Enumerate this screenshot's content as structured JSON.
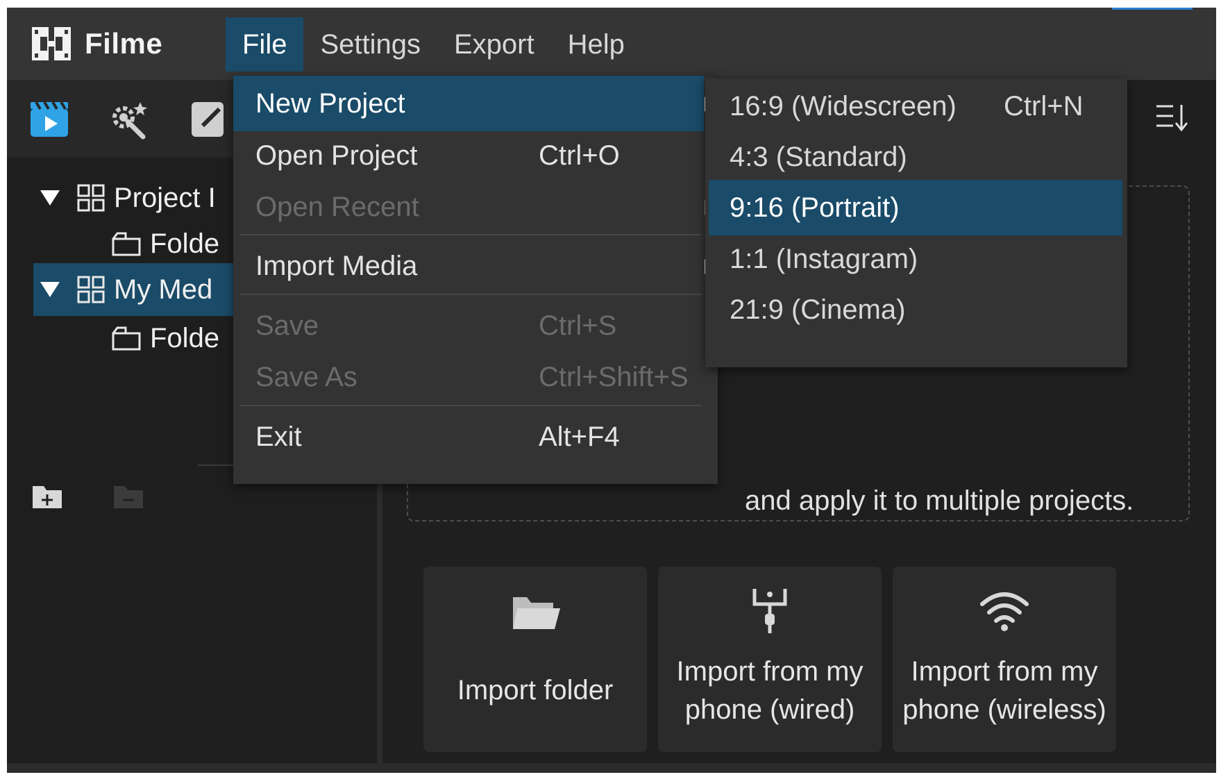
{
  "app": {
    "name": "Filme"
  },
  "menubar": {
    "items": [
      {
        "label": "File",
        "active": true
      },
      {
        "label": "Settings",
        "active": false
      },
      {
        "label": "Export",
        "active": false
      },
      {
        "label": "Help",
        "active": false
      }
    ]
  },
  "toolbar": {
    "icons": [
      "clapperboard-play-icon",
      "magic-effects-icon",
      "edit-icon"
    ]
  },
  "tree": {
    "items": [
      {
        "label": "Project I",
        "icon": "grid-icon",
        "expanded": true
      },
      {
        "label": "Folde",
        "icon": "folder-icon"
      },
      {
        "label": "My Med",
        "icon": "grid-icon",
        "expanded": true,
        "selected": true
      },
      {
        "label": "Folde",
        "icon": "folder-icon"
      }
    ]
  },
  "main": {
    "dropzone_text": "and apply it to multiple projects.",
    "import_cards": [
      {
        "label": "Import folder",
        "icon": "open-folder-icon"
      },
      {
        "label": "Import from my phone (wired)",
        "icon": "usb-cable-icon"
      },
      {
        "label": "Import from my phone (wireless)",
        "icon": "wifi-icon"
      }
    ]
  },
  "file_menu": {
    "items": [
      {
        "label": "New Project",
        "shortcut": "",
        "submenu": true,
        "highlighted": true,
        "disabled": false
      },
      {
        "label": "Open Project",
        "shortcut": "Ctrl+O",
        "submenu": false,
        "highlighted": false,
        "disabled": false
      },
      {
        "label": "Open Recent",
        "shortcut": "",
        "submenu": true,
        "highlighted": false,
        "disabled": true
      },
      {
        "label": "Import Media",
        "shortcut": "",
        "submenu": true,
        "highlighted": false,
        "disabled": false
      },
      {
        "label": "Save",
        "shortcut": "Ctrl+S",
        "submenu": false,
        "highlighted": false,
        "disabled": true
      },
      {
        "label": "Save As",
        "shortcut": "Ctrl+Shift+S",
        "submenu": false,
        "highlighted": false,
        "disabled": true
      },
      {
        "label": "Exit",
        "shortcut": "Alt+F4",
        "submenu": false,
        "highlighted": false,
        "disabled": false
      }
    ]
  },
  "new_project_submenu": {
    "items": [
      {
        "label": "16:9 (Widescreen)",
        "shortcut": "Ctrl+N",
        "highlighted": false
      },
      {
        "label": "4:3 (Standard)",
        "shortcut": "",
        "highlighted": false
      },
      {
        "label": "9:16 (Portrait)",
        "shortcut": "",
        "highlighted": true
      },
      {
        "label": "1:1 (Instagram)",
        "shortcut": "",
        "highlighted": false
      },
      {
        "label": "21:9 (Cinema)",
        "shortcut": "",
        "highlighted": false
      }
    ]
  },
  "colors": {
    "accent": "#1a4b68",
    "topbar": "#353535",
    "background": "#1e1e1e",
    "menu_bg": "#333333"
  }
}
